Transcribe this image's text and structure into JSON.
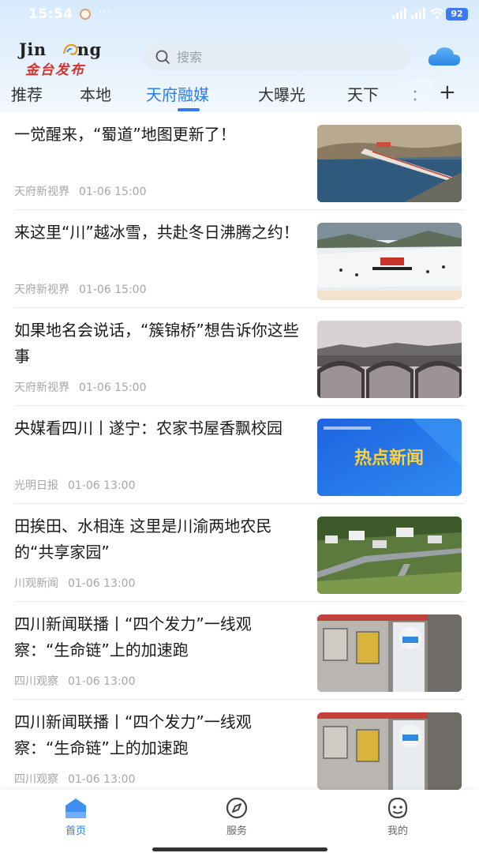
{
  "status_bar": {
    "time": "15:54",
    "dots": "···",
    "battery": "92"
  },
  "header": {
    "logo_text": "JinCeng",
    "logo_sub": "金台发布",
    "search_placeholder": "搜索",
    "weather_icon": "cloud-icon"
  },
  "tabs": [
    {
      "label": "推荐",
      "active": false
    },
    {
      "label": "本地",
      "active": false
    },
    {
      "label": "天府融媒",
      "active": true
    },
    {
      "label": "大曝光",
      "active": false
    },
    {
      "label": "天下",
      "active": false
    },
    {
      "label": "：",
      "active": false
    }
  ],
  "tab_add": "+",
  "news": [
    {
      "title": "一觉醒来，“蜀道”地图更新了！",
      "source": "天府新视界",
      "time": "01-06 15:00",
      "thumb": "bridge-aerial-photo"
    },
    {
      "title": "来这里“川”越冰雪，共赴冬日沸腾之约！",
      "source": "天府新视界",
      "time": "01-06 15:00",
      "thumb": "ski-resort-photo"
    },
    {
      "title": "如果地名会说话，“簇锦桥”想告诉你这些事",
      "source": "天府新视界",
      "time": "01-06 15:00",
      "thumb": "old-stone-bridge-photo"
    },
    {
      "title": "央媒看四川丨遂宁：农家书屋香飘校园",
      "source": "光明日报",
      "time": "01-06 13:00",
      "thumb": "hot-news-banner",
      "thumb_text": "热点新闻"
    },
    {
      "title": "田挨田、水相连 这里是川渝两地农民的“共享家园”",
      "source": "川观新闻",
      "time": "01-06 13:00",
      "thumb": "village-aerial-photo"
    },
    {
      "title": "四川新闻联播丨“四个发力”一线观察：“生命链”上的加速跑",
      "source": "四川观察",
      "time": "01-06 13:00",
      "thumb": "lab-worker-photo"
    },
    {
      "title": "四川新闻联播丨“四个发力”一线观察：“生命链”上的加速跑",
      "source": "四川观察",
      "time": "01-06 13:00",
      "thumb": "lab-worker-photo"
    }
  ],
  "bottom_nav": [
    {
      "label": "首页",
      "icon": "home-icon",
      "active": true
    },
    {
      "label": "服务",
      "icon": "compass-icon",
      "active": false
    },
    {
      "label": "我的",
      "icon": "face-icon",
      "active": false
    }
  ],
  "colors": {
    "accent": "#2b7de9",
    "header_bg": "#d7eafc",
    "meta_text": "#a6a6a6"
  }
}
